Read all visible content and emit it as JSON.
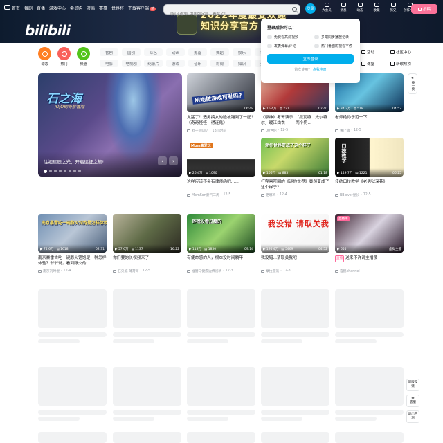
{
  "header": {
    "nav": [
      {
        "label": "首页",
        "icon": "tv-icon"
      },
      {
        "label": "番剧"
      },
      {
        "label": "直播"
      },
      {
        "label": "游戏中心"
      },
      {
        "label": "会员购"
      },
      {
        "label": "漫画"
      },
      {
        "label": "赛事"
      },
      {
        "label": "世界杯"
      },
      {
        "label": "下载客户端",
        "badge": "热"
      }
    ],
    "logo": "bilibili",
    "search_placeholder": "《阿凡达3》中国版定档，看瞎了！",
    "avatar_label": "登录",
    "right_icons": [
      "大会员",
      "消息",
      "动态",
      "收藏",
      "历史",
      "创作中心"
    ],
    "upload_label": "投稿",
    "banner_art": [
      "2022年度最受欢迎",
      "知识分享官方"
    ]
  },
  "channels": {
    "circles": [
      {
        "label": "动态",
        "color": "#ff7f24"
      },
      {
        "label": "热门",
        "color": "#f9605a"
      },
      {
        "label": "频道",
        "color": "#52c41a"
      }
    ],
    "tags": [
      "番剧",
      "国创",
      "综艺",
      "动画",
      "鬼畜",
      "舞蹈",
      "娱乐",
      "科技",
      "电影",
      "电视剧",
      "纪录片",
      "游戏",
      "音乐",
      "影视",
      "知识",
      "资讯"
    ],
    "extra_links": [
      {
        "label": "活动",
        "icon": "calendar-icon"
      },
      {
        "label": "社区中心",
        "icon": "community-icon"
      },
      {
        "label": "课堂",
        "icon": "classroom-icon"
      },
      {
        "label": "新歌热榜",
        "icon": "music-chart-icon"
      }
    ]
  },
  "login_popup": {
    "title": "登录后你可以：",
    "benefits": [
      "免费看高清视频",
      "多端同步播放记录",
      "发表弹幕/评论",
      "热门番剧影视看不停"
    ],
    "button": "立即登录",
    "register_prompt": "首次使用？",
    "register_link": "点我注册"
  },
  "carousel": {
    "title_art": "石之海",
    "subtitle_art": "JOJO的奇妙冒险",
    "caption": "注视星辰之光，开启远征之旅!",
    "dots": 8,
    "active_dot": 0
  },
  "feed": [
    {
      "title": "太猛了！造男搞女的脸被锤到了一起！《奇奇怪怪：得连鬼》",
      "author": "丸子叨叨叨",
      "date": "18小时前",
      "views": "",
      "comments": "",
      "duration": "06:48",
      "overlay": "用她做游戏可耻吗?"
    },
    {
      "title": "《原神》考哥演示：「提瓦特：史尔特尔」暖江由衣 —— 两个奶...",
      "author": "00世纪",
      "date": "12-5",
      "views": "16.4万",
      "comments": "221",
      "duration": "02:40",
      "overlay": ""
    },
    {
      "title": "老师给你示范一下",
      "author": "黄止猿",
      "date": "12-5",
      "views": "34.3万",
      "comments": "518",
      "duration": "04:52",
      "overlay": ""
    },
    {
      "title": "这样应该不会有律师函吧......",
      "author": "MomSon蒙汽三周",
      "date": "12-5",
      "views": "26.4万",
      "comments": "1090",
      "duration": "",
      "overlay": "Mom真爱玩"
    },
    {
      "title": "打完害可回的《迷你世界》竟然变成了这个样子？",
      "author": "老哪鸡",
      "date": "12-4",
      "views": "106万",
      "comments": "883",
      "duration": "01:18",
      "overlay": "迷你世界变成了这个样子"
    },
    {
      "title": "传统口技教学《老男狱深巷》",
      "author": "BBlover星长",
      "date": "12-5",
      "views": "149.7万",
      "comments": "1221",
      "duration": "06:25",
      "overlay": "口技教学"
    },
    {
      "title": "南京暴雷古吃一碗豚火馆饱是一种怎样体验？爷爷说，看到豚火的...",
      "author": "南京刘时棍",
      "date": "12-4",
      "views": "74.6万",
      "comments": "1618",
      "duration": "02:31",
      "overlay": "南京暴雷吃一碗豚火馆饱是怎样体验"
    },
    {
      "title": "你们要的长视频来了",
      "author": "石央城-薄荷哥",
      "date": "12-5",
      "views": "57.6万",
      "comments": "1137",
      "duration": "16:22",
      "overlay": ""
    },
    {
      "title": "有使命感的人，根本没时间躺平",
      "author": "准厨马健震边佛初新",
      "date": "12-3",
      "views": "113万",
      "comments": "1850",
      "duration": "09:14",
      "overlay": "昨晚没看过瘾的"
    },
    {
      "title": "我没错...请取关我吧",
      "author": "摩拉嘉藻",
      "date": "12-3",
      "views": "195.4万",
      "comments": "5469",
      "duration": "04:52",
      "overlay": "我没错 请取关我吧"
    },
    {
      "title": "送来不许说主播傻",
      "author": "宫鹏channel",
      "date": "",
      "views": "655",
      "comments": "",
      "duration": "虚拟主播",
      "overlay": "",
      "live": "直播",
      "live_tag": "直播中"
    }
  ],
  "refresh_label": "换一换",
  "float_bar": [
    "新版反馈",
    "客服",
    "退出内测"
  ]
}
